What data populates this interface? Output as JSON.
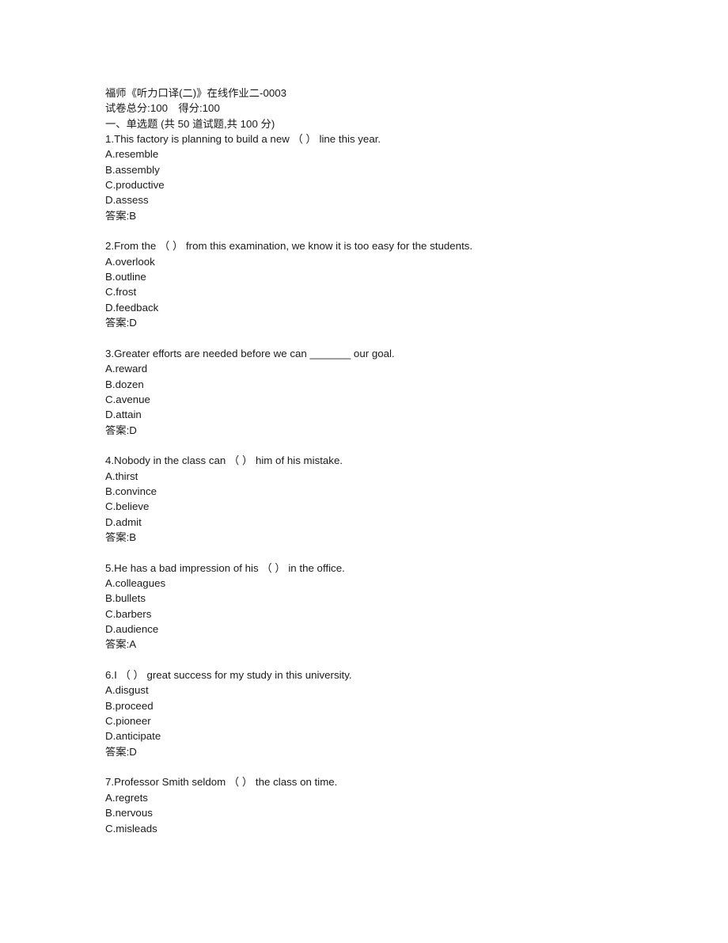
{
  "document": {
    "title": "福师《听力口译(二)》在线作业二-0003",
    "score_line": "试卷总分:100　得分:100",
    "section_heading": "一、单选题 (共 50 道试题,共 100 分)",
    "answer_prefix": "答案:",
    "questions": [
      {
        "number": "1.",
        "stem": "1.This factory is planning to build a new （ ） line this year.",
        "options": [
          "A.resemble",
          "B.assembly",
          "C.productive",
          "D.assess"
        ],
        "answer": "答案:B"
      },
      {
        "number": "2.",
        "stem": "2.From the （ ） from this examination, we know it is too easy for the students.",
        "options": [
          "A.overlook",
          "B.outline",
          "C.frost",
          "D.feedback"
        ],
        "answer": "答案:D"
      },
      {
        "number": "3.",
        "stem": "3.Greater efforts are needed before we can _______ our goal.",
        "options": [
          "A.reward",
          "B.dozen",
          "C.avenue",
          "D.attain"
        ],
        "answer": "答案:D"
      },
      {
        "number": "4.",
        "stem": "4.Nobody in the class can （ ） him of his mistake.",
        "options": [
          "A.thirst",
          "B.convince",
          "C.believe",
          "D.admit"
        ],
        "answer": "答案:B"
      },
      {
        "number": "5.",
        "stem": "5.He has a bad impression of his （ ） in the office.",
        "options": [
          "A.colleagues",
          "B.bullets",
          "C.barbers",
          "D.audience"
        ],
        "answer": "答案:A"
      },
      {
        "number": "6.",
        "stem": "6.I （ ） great success for my study in this university.",
        "options": [
          "A.disgust",
          "B.proceed",
          "C.pioneer",
          "D.anticipate"
        ],
        "answer": "答案:D"
      },
      {
        "number": "7.",
        "stem": "7.Professor Smith seldom （ ） the class on time.",
        "options": [
          "A.regrets",
          "B.nervous",
          "C.misleads"
        ],
        "answer": ""
      }
    ]
  }
}
